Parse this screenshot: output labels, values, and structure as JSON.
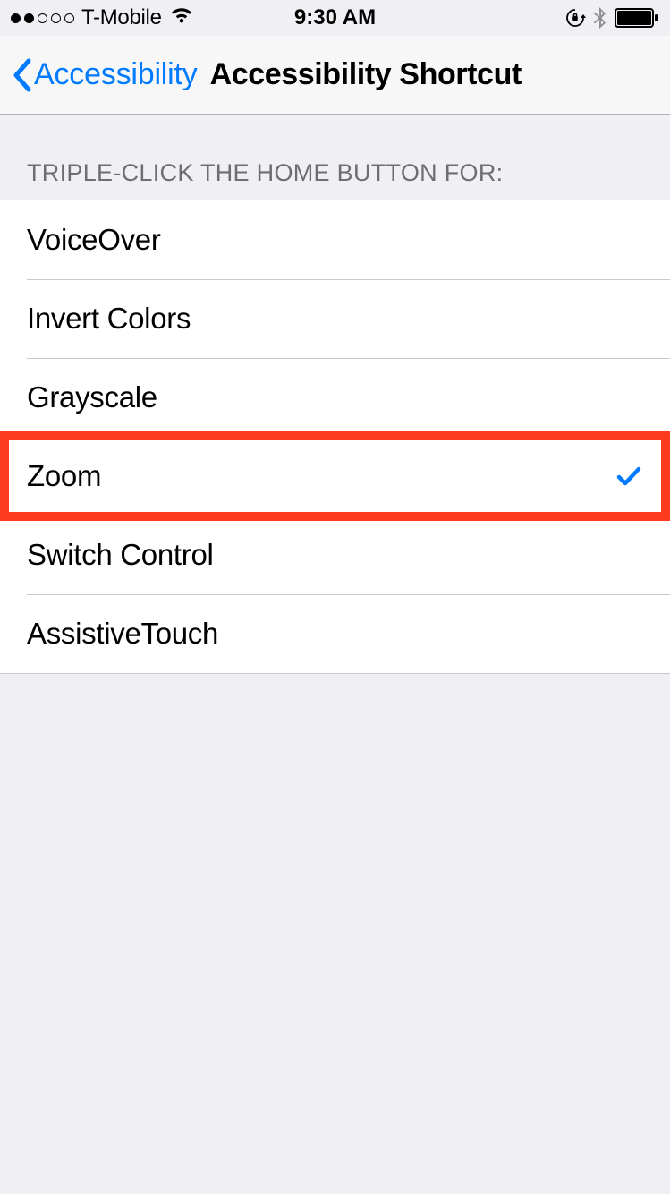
{
  "status": {
    "carrier": "T-Mobile",
    "time": "9:30 AM"
  },
  "nav": {
    "back_label": "Accessibility",
    "title": "Accessibility Shortcut"
  },
  "section": {
    "header": "TRIPLE-CLICK THE HOME BUTTON FOR:"
  },
  "options": [
    {
      "label": "VoiceOver",
      "selected": false
    },
    {
      "label": "Invert Colors",
      "selected": false
    },
    {
      "label": "Grayscale",
      "selected": false
    },
    {
      "label": "Zoom",
      "selected": true,
      "highlighted": true
    },
    {
      "label": "Switch Control",
      "selected": false
    },
    {
      "label": "AssistiveTouch",
      "selected": false
    }
  ]
}
